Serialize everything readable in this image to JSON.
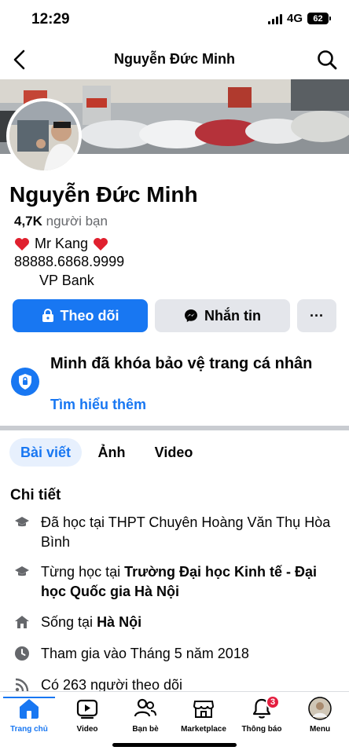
{
  "status_bar": {
    "time": "12:29",
    "network": "4G",
    "battery": "62"
  },
  "header": {
    "title": "Nguyễn Đức Minh"
  },
  "profile": {
    "name": "Nguyễn Đức Minh",
    "friends_count": "4,7K",
    "friends_label": "người bạn",
    "bio_line1": "Mr Kang",
    "bio_line2": "88888.6868.9999",
    "bio_line3": "VP Bank"
  },
  "actions": {
    "follow": "Theo dõi",
    "message": "Nhắn tin",
    "more": "···"
  },
  "lock_notice": {
    "title": "Minh đã khóa bảo vệ trang cá nhân",
    "link": "Tìm hiểu thêm"
  },
  "tabs": [
    {
      "label": "Bài viết"
    },
    {
      "label": "Ảnh"
    },
    {
      "label": "Video"
    }
  ],
  "details": {
    "title": "Chi tiết",
    "items": [
      {
        "prefix": "Đã học tại THPT Chuyên Hoàng Văn Thụ Hòa Bình",
        "bold": ""
      },
      {
        "prefix": "Từng học tại ",
        "bold": "Trường Đại học Kinh tế - Đại học Quốc gia Hà Nội"
      },
      {
        "prefix": "Sống tại ",
        "bold": "Hà Nội"
      },
      {
        "prefix": "Tham gia vào Tháng 5 năm 2018",
        "bold": ""
      },
      {
        "prefix": "Có 263 người theo dõi",
        "bold": ""
      }
    ]
  },
  "bottom_nav": [
    {
      "label": "Trang chủ"
    },
    {
      "label": "Video"
    },
    {
      "label": "Bạn bè"
    },
    {
      "label": "Marketplace"
    },
    {
      "label": "Thông báo",
      "badge": "3"
    },
    {
      "label": "Menu"
    }
  ],
  "colors": {
    "accent": "#1877f2",
    "button_gray": "#e4e6eb",
    "badge": "#e41e3f"
  }
}
